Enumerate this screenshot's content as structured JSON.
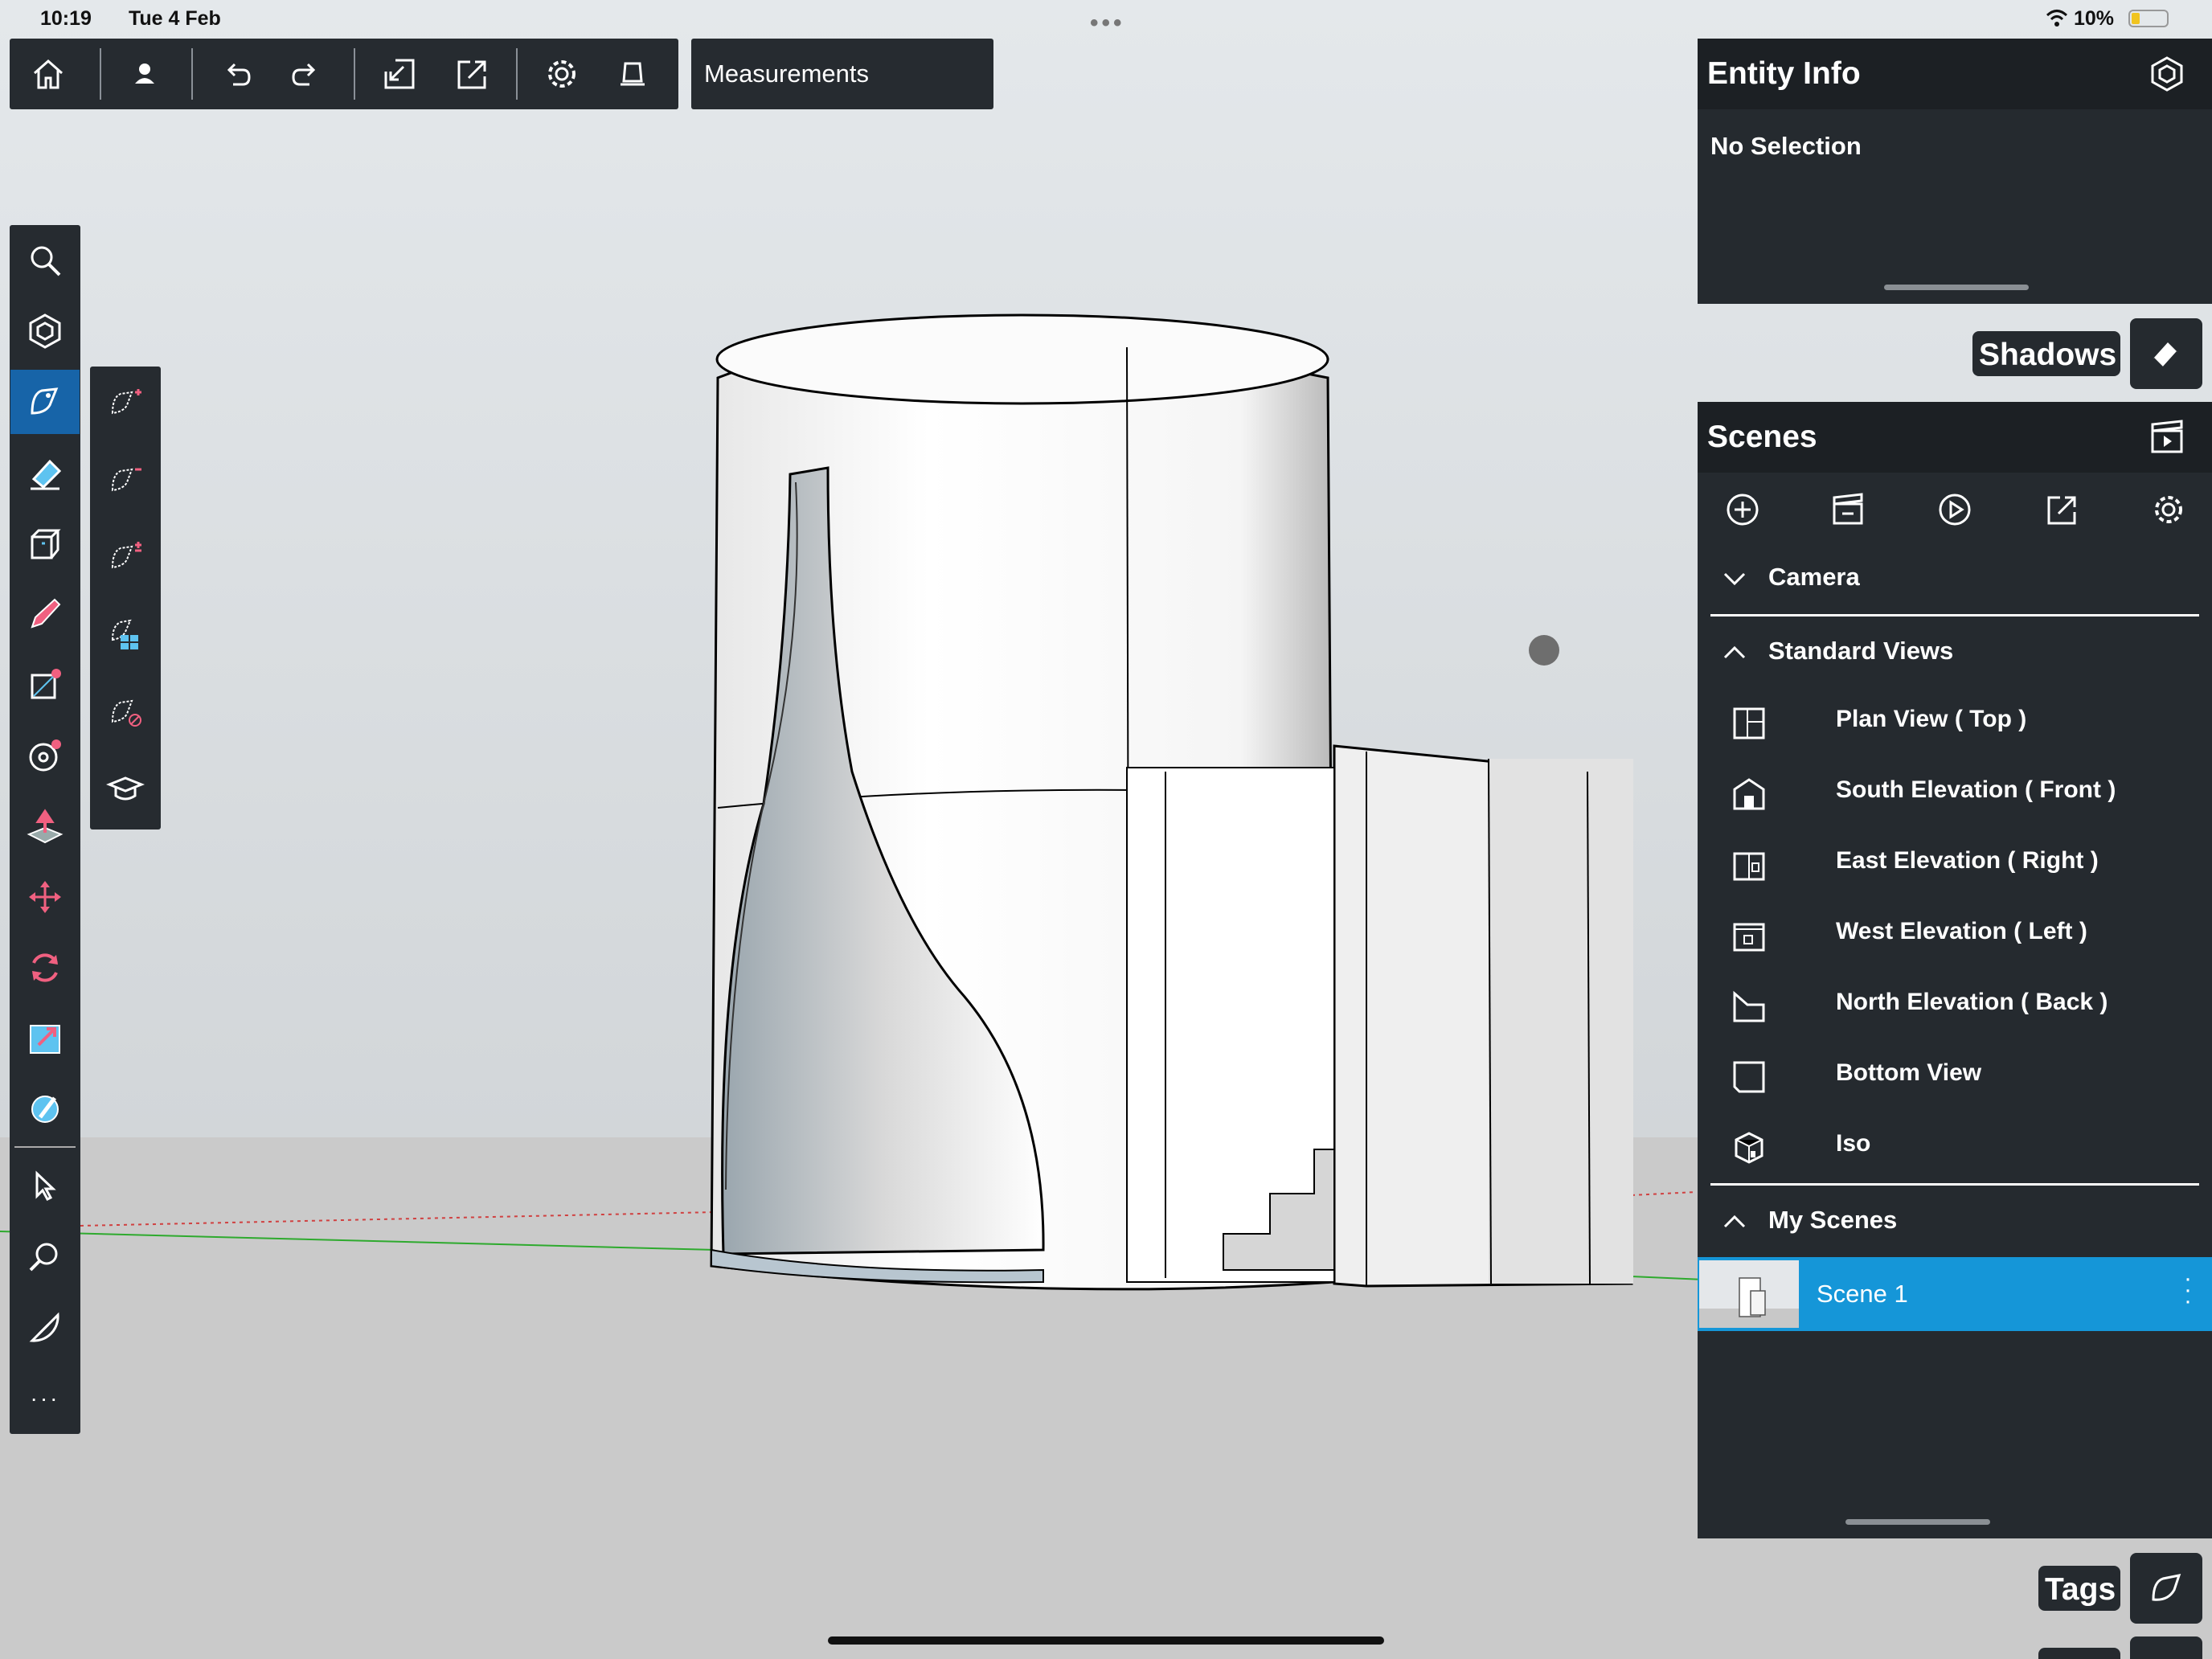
{
  "status_bar": {
    "time": "10:19",
    "date": "Tue 4 Feb",
    "battery": "10%"
  },
  "toolbar": {
    "icons": [
      "home-icon",
      "user-icon",
      "undo-icon",
      "redo-icon",
      "import-icon",
      "export-icon",
      "settings-icon",
      "eraser-scroll-icon"
    ],
    "title": "Measurements"
  },
  "left_tools": [
    "search-icon",
    "components-icon",
    "tag-tool-icon",
    "eraser-icon",
    "box-icon",
    "pencil-icon",
    "rectangle-icon",
    "circle-icon",
    "push-pull-icon",
    "move-icon",
    "rotate-icon",
    "scale-icon",
    "paint-icon",
    "select-icon",
    "zoom-icon",
    "protractor-icon",
    "more-icon"
  ],
  "sub_tools": [
    "tag-add-icon",
    "tag-remove-icon",
    "tag-toggle-icon",
    "tag-grid-icon",
    "tag-clear-icon",
    "learn-icon"
  ],
  "entity_info": {
    "title": "Entity Info",
    "selection": "No Selection"
  },
  "shadows_label": "Shadows",
  "scenes": {
    "title": "Scenes",
    "sections": {
      "camera": "Camera",
      "standard_views": "Standard Views",
      "my_scenes": "My Scenes"
    },
    "views": [
      "Plan View ( Top )",
      "South Elevation ( Front )",
      "East Elevation ( Right )",
      "West Elevation ( Left )",
      "North Elevation ( Back )",
      "Bottom View",
      "Iso"
    ],
    "scene_items": [
      "Scene 1"
    ]
  },
  "tags_label": "Tags",
  "colors": {
    "panel": "#252a2f",
    "accent": "#1596d8",
    "active_tool": "#1764a8"
  }
}
